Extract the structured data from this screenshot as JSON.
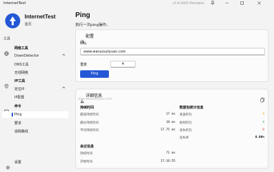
{
  "window": {
    "title": "InternetTest",
    "version": "v7.6.2403 (Portable)"
  },
  "sidebar": {
    "app_name": "InternetTest",
    "app_sub": "首页",
    "section_label": "工具",
    "groups": [
      {
        "label": "网络工具",
        "items": [
          "DownDetector",
          "DNS工具",
          "无线网络"
        ]
      },
      {
        "label": "IP工具",
        "items": [
          "定位IP",
          "IP配置"
        ]
      },
      {
        "label": "命令",
        "items": [
          "Ping",
          "要求",
          "追踪路线"
        ]
      }
    ],
    "settings_label": "设置"
  },
  "main": {
    "title": "Ping",
    "description": "执行一次ping操作。"
  },
  "config": {
    "title": "配置",
    "url_label": "URL",
    "url_value": "www.wanyouziyuan.com",
    "count_label": "重复",
    "count_value": "4",
    "ping_button": "Ping"
  },
  "details": {
    "title": "详细信息",
    "watermark": "www.wanyouziyuan.com",
    "latency": {
      "title": "持续时间",
      "rows": [
        {
          "label": "最低持续时间",
          "value": "17 ms"
        },
        {
          "label": "最长持续时间",
          "value": "18 ms"
        },
        {
          "label": "平均持续时间",
          "value": "17.75 ms"
        }
      ]
    },
    "packets": {
      "title": "数据包统计信息",
      "rows": [
        {
          "label": "发送的包",
          "value": "4"
        },
        {
          "label": "收到的包",
          "value": "4"
        },
        {
          "label": "丢失的包",
          "value": "0"
        },
        {
          "label": "丢失率",
          "value": "0.00%"
        }
      ],
      "colors": {
        "sent": "#e8a800",
        "received": "#2fa84f",
        "lost": "#d83b3b"
      }
    },
    "session": {
      "title": "会议信息",
      "rows": [
        {
          "label": "持续时间",
          "value": "71 ms"
        },
        {
          "label": "开始时间",
          "value": "17:16:55"
        }
      ]
    }
  },
  "colors": {
    "accent": "#2457d6"
  }
}
